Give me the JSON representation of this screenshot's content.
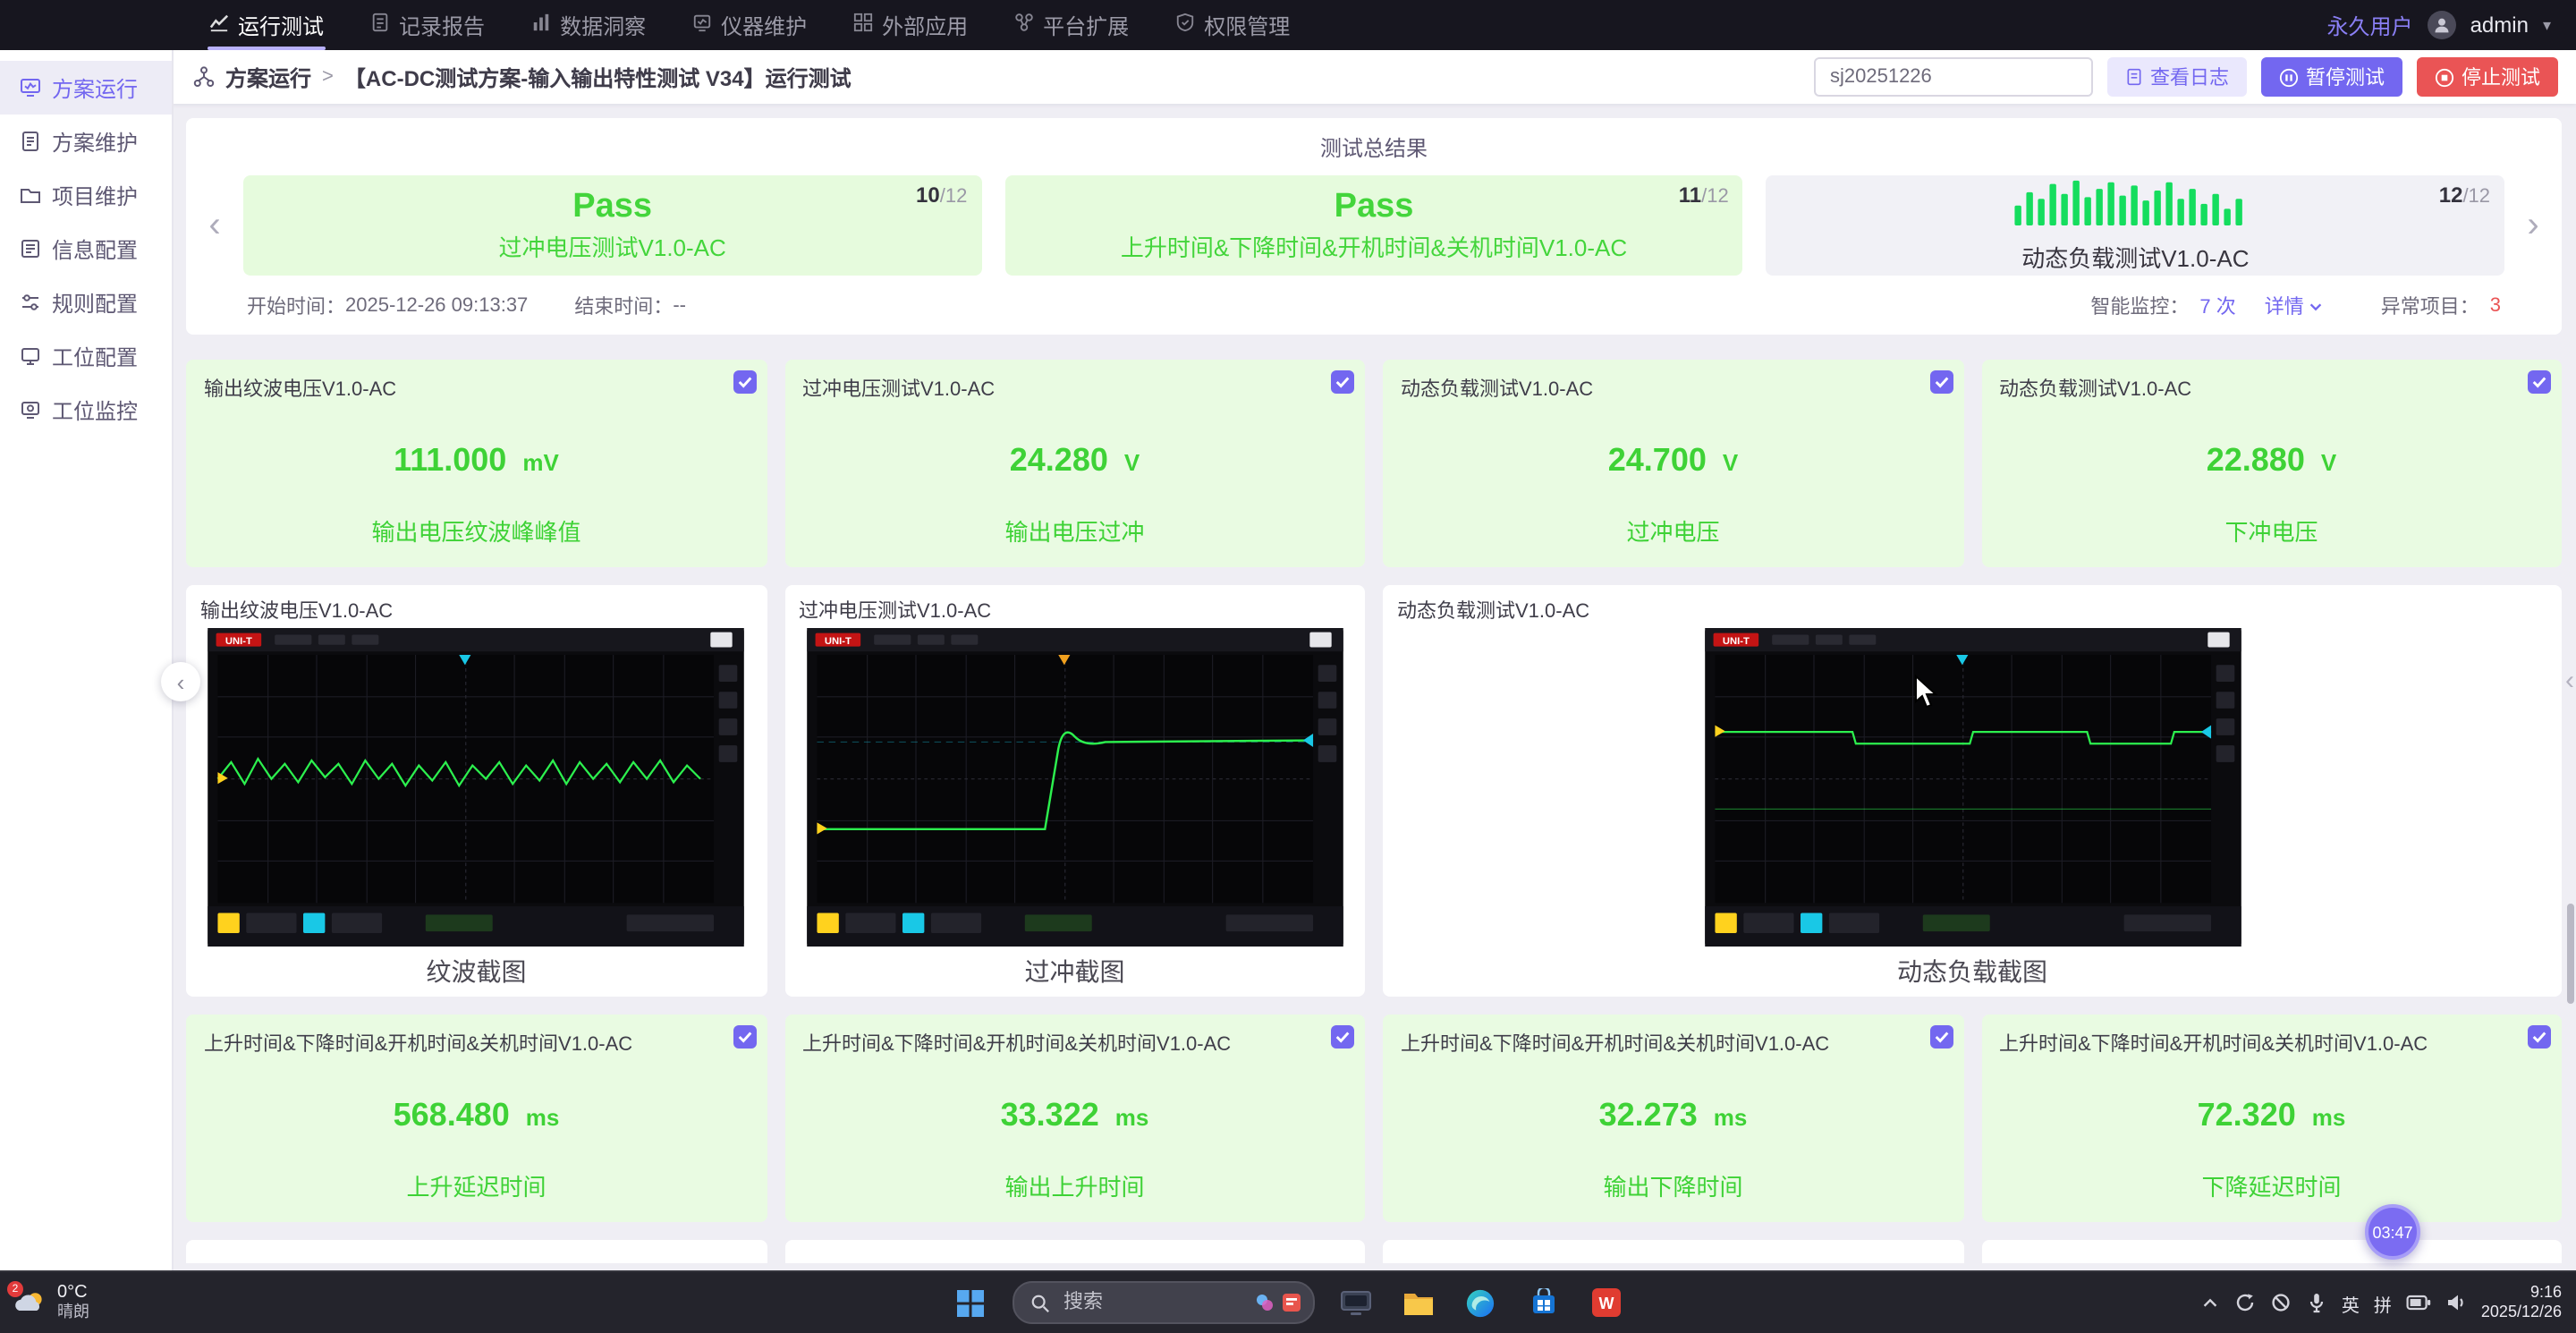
{
  "colors": {
    "accent": "#7367f0",
    "pass_green": "#3ed236",
    "danger_red": "#ea5455",
    "pass_bg": "#e6fbdd",
    "card_green_bg": "#e9fbe2"
  },
  "topnav": {
    "items": [
      {
        "label": "运行测试",
        "active": true
      },
      {
        "label": "记录报告"
      },
      {
        "label": "数据洞察"
      },
      {
        "label": "仪器维护"
      },
      {
        "label": "外部应用"
      },
      {
        "label": "平台扩展"
      },
      {
        "label": "权限管理"
      }
    ],
    "user_type": "永久用户",
    "username": "admin"
  },
  "sidebar": {
    "items": [
      {
        "label": "方案运行",
        "active": true
      },
      {
        "label": "方案维护"
      },
      {
        "label": "项目维护"
      },
      {
        "label": "信息配置"
      },
      {
        "label": "规则配置"
      },
      {
        "label": "工位配置"
      },
      {
        "label": "工位监控"
      }
    ]
  },
  "header": {
    "breadcrumb_root": "方案运行",
    "breadcrumb_sep": ">",
    "breadcrumb_current": "【AC-DC测试方案-输入输出特性测试 V34】运行测试",
    "job_input": "sj20251226",
    "view_log": "查看日志",
    "pause": "暂停测试",
    "stop": "停止测试"
  },
  "summary": {
    "title": "测试总结果",
    "cards": [
      {
        "status": "Pass",
        "name": "过冲电压测试V1.0-AC",
        "index": "10",
        "total": "/12"
      },
      {
        "status": "Pass",
        "name": "上升时间&下降时间&开机时间&关机时间V1.0-AC",
        "index": "11",
        "total": "/12"
      },
      {
        "status": "",
        "name": "动态负载测试V1.0-AC",
        "index": "12",
        "total": "/12"
      }
    ],
    "start_label": "开始时间：",
    "start_time": "2025-12-26 09:13:37",
    "end_label": "结束时间：",
    "end_time": "--",
    "monitor_label": "智能监控：",
    "monitor_value": "7 次",
    "detail": "详情",
    "abnormal_label": "异常项目：",
    "abnormal_value": "3"
  },
  "measurements": [
    {
      "title": "输出纹波电压V1.0-AC",
      "value": "111.000",
      "unit": "mV",
      "label": "输出电压纹波峰峰值"
    },
    {
      "title": "过冲电压测试V1.0-AC",
      "value": "24.280",
      "unit": "V",
      "label": "输出电压过冲"
    },
    {
      "title": "动态负载测试V1.0-AC",
      "value": "24.700",
      "unit": "V",
      "label": "过冲电压"
    },
    {
      "title": "动态负载测试V1.0-AC",
      "value": "22.880",
      "unit": "V",
      "label": "下冲电压"
    },
    {
      "title": "上升时间&下降时间&开机时间&关机时间V1.0-AC",
      "value": "568.480",
      "unit": "ms",
      "label": "上升延迟时间"
    },
    {
      "title": "上升时间&下降时间&开机时间&关机时间V1.0-AC",
      "value": "33.322",
      "unit": "ms",
      "label": "输出上升时间"
    },
    {
      "title": "上升时间&下降时间&开机时间&关机时间V1.0-AC",
      "value": "32.273",
      "unit": "ms",
      "label": "输出下降时间"
    },
    {
      "title": "上升时间&下降时间&开机时间&关机时间V1.0-AC",
      "value": "72.320",
      "unit": "ms",
      "label": "下降延迟时间"
    }
  ],
  "scopes": [
    {
      "title": "输出纹波电压V1.0-AC",
      "caption": "纹波截图",
      "brand": "UNI-T"
    },
    {
      "title": "过冲电压测试V1.0-AC",
      "caption": "过冲截图",
      "brand": "UNI-T"
    },
    {
      "title": "动态负载测试V1.0-AC",
      "caption": "动态负载截图",
      "brand": "UNI-T"
    }
  ],
  "timer_badge": "03:47",
  "taskbar": {
    "weather_temp": "0°C",
    "weather_desc": "晴朗",
    "weather_badge": "2",
    "search_placeholder": "搜索",
    "lang1": "英",
    "lang2": "拼",
    "wps_letter": "W",
    "time": "9:16",
    "date": "2025/12/26"
  }
}
